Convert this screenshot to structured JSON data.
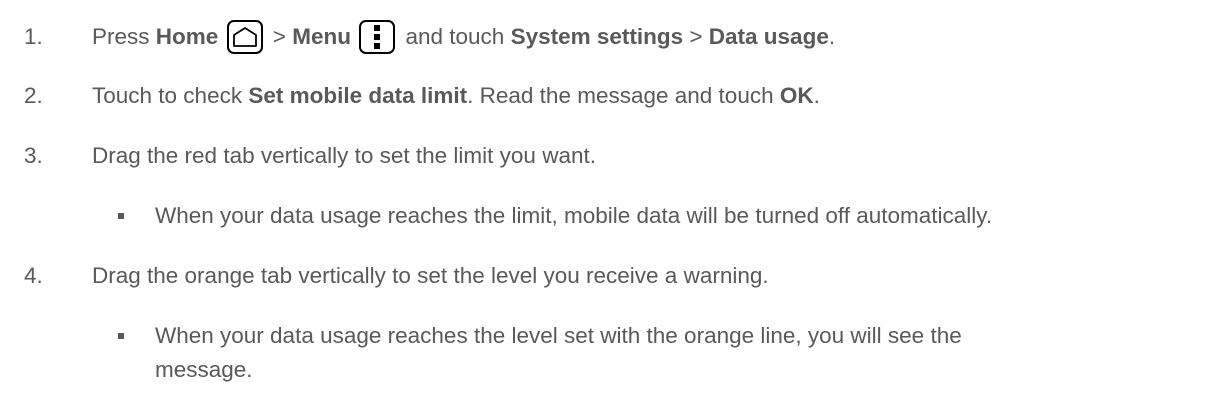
{
  "steps": [
    {
      "num": "1.",
      "p1": "Press ",
      "home": "Home",
      "sep1": " > ",
      "menu": "Menu",
      "p2": " and touch ",
      "system_settings": "System settings",
      "sep2": " > ",
      "data_usage": "Data usage",
      "end": "."
    },
    {
      "num": "2.",
      "p1": "Touch to check ",
      "set_limit": "Set mobile data limit",
      "p2": ". Read the message and touch ",
      "ok": "OK",
      "end": "."
    },
    {
      "num": "3.",
      "text": "Drag the red tab vertically to set the limit you want.",
      "bullet": "When your data usage reaches the limit, mobile data will be turned off automatically."
    },
    {
      "num": "4.",
      "text": "Drag the orange tab vertically to set the level you receive a warning.",
      "bullet_line1": "When your data usage reaches the level set with the orange line, you will see the",
      "bullet_line2": "message."
    }
  ],
  "icons": [
    "home-icon",
    "menu-icon"
  ]
}
